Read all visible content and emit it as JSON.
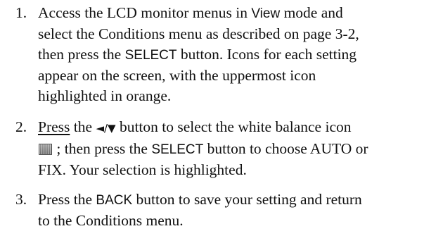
{
  "steps": [
    {
      "number": "1.",
      "lines": [
        {
          "a": "Access the LCD monitor menus in ",
          "ui": "View",
          "b": " mode and"
        },
        {
          "a": "select the Conditions menu as described on page 3-2,"
        },
        {
          "a": "then press the ",
          "ui": "SELECT",
          "b": " button. Icons for each setting"
        },
        {
          "a": "appear on the screen, with the uppermost icon"
        },
        {
          "a": "highlighted in orange."
        }
      ]
    },
    {
      "number": "2.",
      "lines": [
        {
          "a1": "Press",
          "a2": " the ",
          "arrows": "◄/▼",
          "b": " button to select the white balance icon"
        },
        {
          "icon": "white-balance-icon",
          "a": " ; then press the ",
          "ui": "SELECT",
          "b": " button to choose AUTO or"
        },
        {
          "a": "FIX. Your selection is highlighted."
        }
      ]
    },
    {
      "number": "3.",
      "lines": [
        {
          "a": "Press the ",
          "ui": "BACK",
          "b": " button to save your setting and return"
        },
        {
          "a": "to the Conditions menu."
        }
      ]
    }
  ]
}
